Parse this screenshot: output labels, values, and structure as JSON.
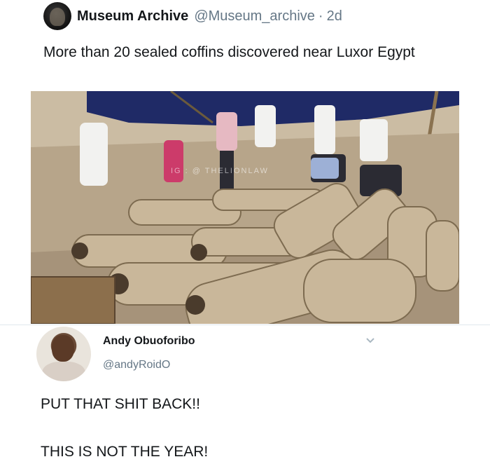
{
  "tweet1": {
    "name": "Museum Archive",
    "handle": "@Museum_archive",
    "separator": "·",
    "time": "2d",
    "text": "More than 20 sealed coffins discovered near Luxor Egypt",
    "image": {
      "alt": "Excavation site with wooden coffins laid out in rows",
      "watermark": "IG : @ THELIONLAW"
    }
  },
  "tweet2": {
    "name": "Andy Obuoforibo",
    "handle": "@andyRoidO",
    "lines": [
      "PUT THAT SHIT BACK!!",
      "THIS IS NOT THE YEAR!"
    ],
    "menu_icon": "chevron-down-icon"
  },
  "colors": {
    "text": "#14171a",
    "secondary": "#657786",
    "divider": "#e1e8ed"
  }
}
